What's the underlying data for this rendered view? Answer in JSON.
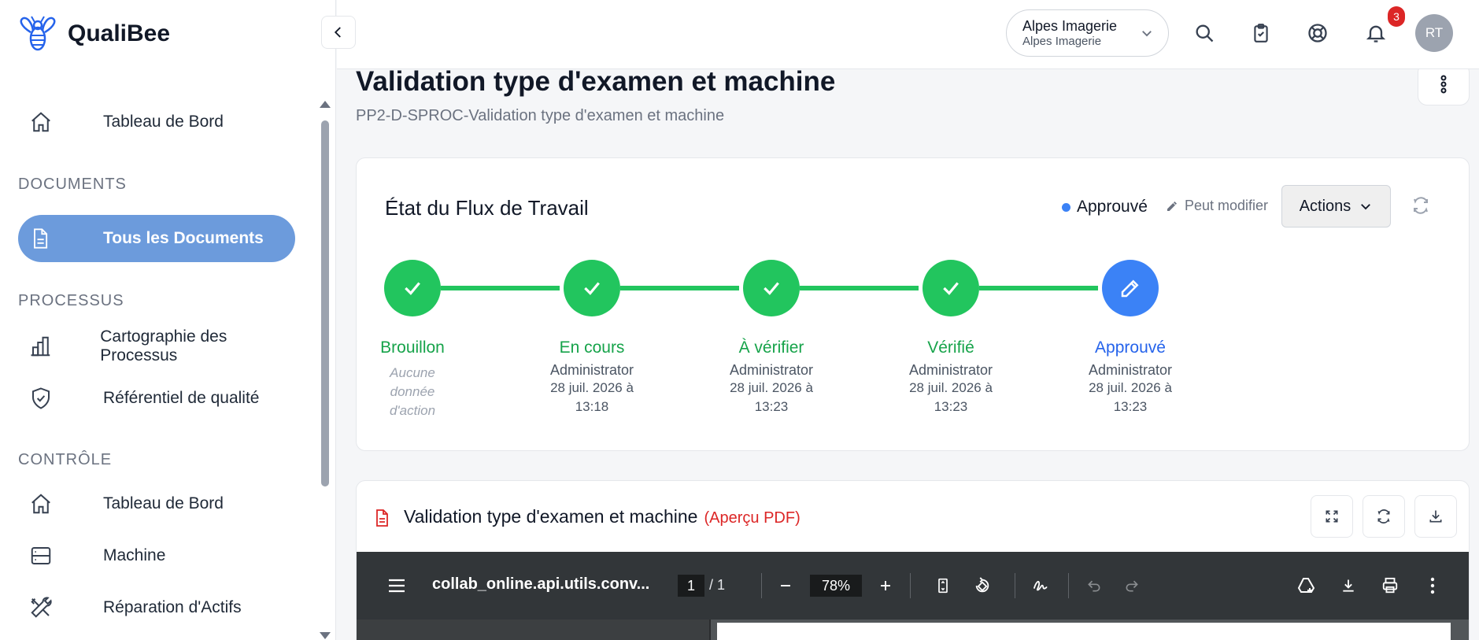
{
  "brand": {
    "name": "QualiBee"
  },
  "sidebar": {
    "items": [
      {
        "label": "Tableau de Bord",
        "icon": "home-icon"
      },
      {
        "label": "Tous les Documents",
        "icon": "document-icon",
        "active": true
      },
      {
        "label": "Cartographie des Processus",
        "icon": "bar-chart-icon"
      },
      {
        "label": "Référentiel de qualité",
        "icon": "shield-check-icon"
      },
      {
        "label": "Tableau de Bord",
        "icon": "home-icon"
      },
      {
        "label": "Machine",
        "icon": "server-icon"
      },
      {
        "label": "Réparation d'Actifs",
        "icon": "tools-icon"
      }
    ],
    "sections": [
      "DOCUMENTS",
      "PROCESSUS",
      "CONTRÔLE"
    ]
  },
  "topbar": {
    "org_name": "Alpes Imagerie",
    "org_sub": "Alpes Imagerie",
    "notifications_count": "3",
    "avatar_initials": "RT"
  },
  "page": {
    "title": "Validation type d'examen et machine",
    "subtitle": "PP2-D-SPROC-Validation type d'examen et machine"
  },
  "workflow": {
    "title": "État du Flux de Travail",
    "status": "Approuvé",
    "edit_label": "Peut modifier",
    "actions_label": "Actions",
    "accent": "#22c55e",
    "current_color": "#3b82f6",
    "steps": [
      {
        "name": "Brouillon",
        "none": "Aucune donnée d'action"
      },
      {
        "name": "En cours",
        "by": "Administrator",
        "date": "28 juil. 2026 à 13:18"
      },
      {
        "name": "À vérifier",
        "by": "Administrator",
        "date": "28 juil. 2026 à 13:23"
      },
      {
        "name": "Vérifié",
        "by": "Administrator",
        "date": "28 juil. 2026 à 13:23"
      },
      {
        "name": "Approuvé",
        "by": "Administrator",
        "date": "28 juil. 2026 à 13:23"
      }
    ]
  },
  "document": {
    "title": "Validation type d'examen et machine",
    "tag": "(Aperçu PDF)",
    "viewer": {
      "filename": "collab_online.api.utils.conv...",
      "page": "1",
      "page_total": "/   1",
      "zoom": "78%"
    }
  }
}
